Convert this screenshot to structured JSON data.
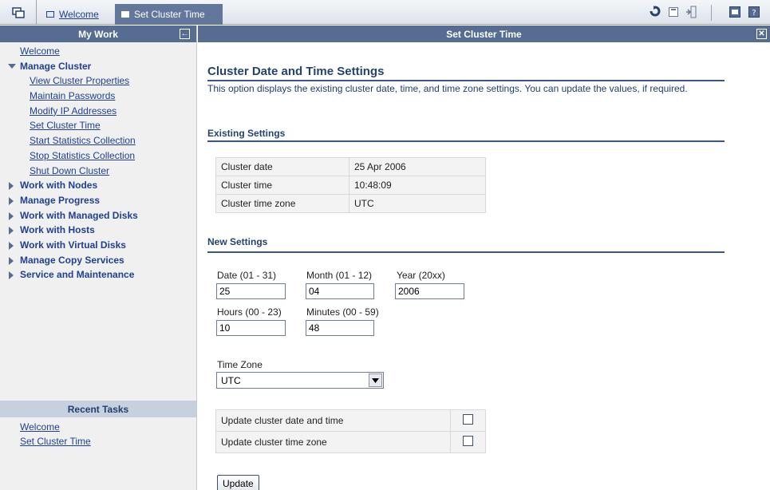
{
  "tabs": [
    {
      "label": "Welcome",
      "active": false
    },
    {
      "label": "Set Cluster Time",
      "active": true
    }
  ],
  "toolbar_icons": [
    "refresh-icon",
    "window-icon",
    "logout-icon",
    "frame-icon",
    "help-icon"
  ],
  "my_work": {
    "title": "My Work",
    "items": {
      "welcome": "Welcome",
      "manage_cluster": "Manage Cluster",
      "sub": [
        "View Cluster Properties",
        "Maintain Passwords",
        "Modify IP Addresses",
        "Set Cluster Time",
        "Start Statistics Collection",
        "Stop Statistics Collection",
        "Shut Down Cluster"
      ],
      "groups": [
        "Work with Nodes",
        "Manage Progress",
        "Work with Managed Disks",
        "Work with Hosts",
        "Work with Virtual Disks",
        "Manage Copy Services",
        "Service and Maintenance"
      ]
    }
  },
  "recent": {
    "title": "Recent Tasks",
    "items": [
      "Welcome",
      "Set Cluster Time"
    ]
  },
  "panel": {
    "title": "Set Cluster Time",
    "heading": "Cluster Date and Time Settings",
    "description": "This option displays the existing cluster date, time, and time zone settings. You can update the values, if required.",
    "existing_heading": "Existing Settings",
    "existing": [
      {
        "label": "Cluster date",
        "value": "25 Apr 2006"
      },
      {
        "label": "Cluster time",
        "value": "10:48:09"
      },
      {
        "label": "Cluster time zone",
        "value": "UTC"
      }
    ],
    "new_heading": "New Settings",
    "fields": {
      "date_label": "Date (01 - 31)",
      "date_value": "25",
      "month_label": "Month (01 - 12)",
      "month_value": "04",
      "year_label": "Year (20xx)",
      "year_value": "2006",
      "hours_label": "Hours (00 - 23)",
      "hours_value": "10",
      "minutes_label": "Minutes (00 - 59)",
      "minutes_value": "48",
      "tz_label": "Time Zone",
      "tz_value": "UTC"
    },
    "options": [
      {
        "label": "Update cluster date and time",
        "checked": false
      },
      {
        "label": "Update cluster time zone",
        "checked": false
      }
    ],
    "update_button": "Update"
  }
}
